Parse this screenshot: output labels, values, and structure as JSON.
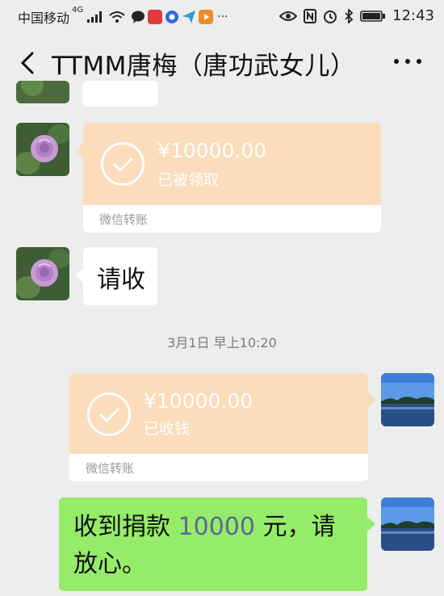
{
  "status_bar": {
    "carrier": "中国移动",
    "network": "4G",
    "time": "12:43"
  },
  "header": {
    "title": "TTMM唐梅（唐功武女儿）"
  },
  "messages": {
    "transfer_received_by_other": {
      "amount": "¥10000.00",
      "status": "已被领取",
      "footer": "微信转账"
    },
    "text_request": {
      "text": "请收"
    },
    "timestamp": "3月1日 早上10:20",
    "transfer_collected": {
      "amount": "¥10000.00",
      "status": "已收钱",
      "footer": "微信转账"
    },
    "reply": {
      "prefix": "收到捐款 ",
      "number": "10000",
      "suffix": " 元，请放心。"
    }
  },
  "colors": {
    "background": "#ededed",
    "transfer_card": "#fbdcbb",
    "sent_bubble": "#95ec69",
    "link_number": "#576b95"
  }
}
